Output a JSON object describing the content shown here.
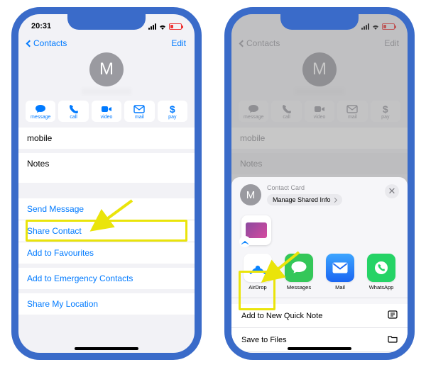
{
  "colors": {
    "accent": "#007aff",
    "highlight": "#eae40a",
    "frame": "#3a6bc9"
  },
  "status": {
    "time": "20:31"
  },
  "phone1": {
    "nav": {
      "back": "Contacts",
      "edit": "Edit"
    },
    "avatar_initial": "M",
    "actions": [
      {
        "icon": "message-icon",
        "label": "message"
      },
      {
        "icon": "phone-icon",
        "label": "call"
      },
      {
        "icon": "video-icon",
        "label": "video"
      },
      {
        "icon": "mail-icon",
        "label": "mail"
      },
      {
        "icon": "pay-icon",
        "label": "pay",
        "glyph": "$"
      }
    ],
    "fields": {
      "mobile": "mobile",
      "notes": "Notes"
    },
    "links": {
      "send_message": "Send Message",
      "share_contact": "Share Contact",
      "add_favourites": "Add to Favourites",
      "add_emergency": "Add to Emergency Contacts",
      "share_location": "Share My Location"
    }
  },
  "phone2": {
    "nav": {
      "back": "Contacts",
      "edit": "Edit"
    },
    "avatar_initial": "M",
    "actions": [
      {
        "label": "message"
      },
      {
        "label": "call"
      },
      {
        "label": "video"
      },
      {
        "label": "mail"
      },
      {
        "label": "pay",
        "glyph": "$"
      }
    ],
    "fields": {
      "mobile": "mobile",
      "notes": "Notes"
    },
    "sheet": {
      "avatar_initial": "M",
      "title": "Contact Card",
      "manage": "Manage Shared Info",
      "apps": [
        {
          "name": "AirDrop",
          "color": "#fff"
        },
        {
          "name": "Messages",
          "color": "#34c759"
        },
        {
          "name": "Mail",
          "color": "#1f6ff0"
        },
        {
          "name": "WhatsApp",
          "color": "#25d366"
        }
      ],
      "items": {
        "quick_note": "Add to New Quick Note",
        "save_files": "Save to Files"
      }
    }
  }
}
